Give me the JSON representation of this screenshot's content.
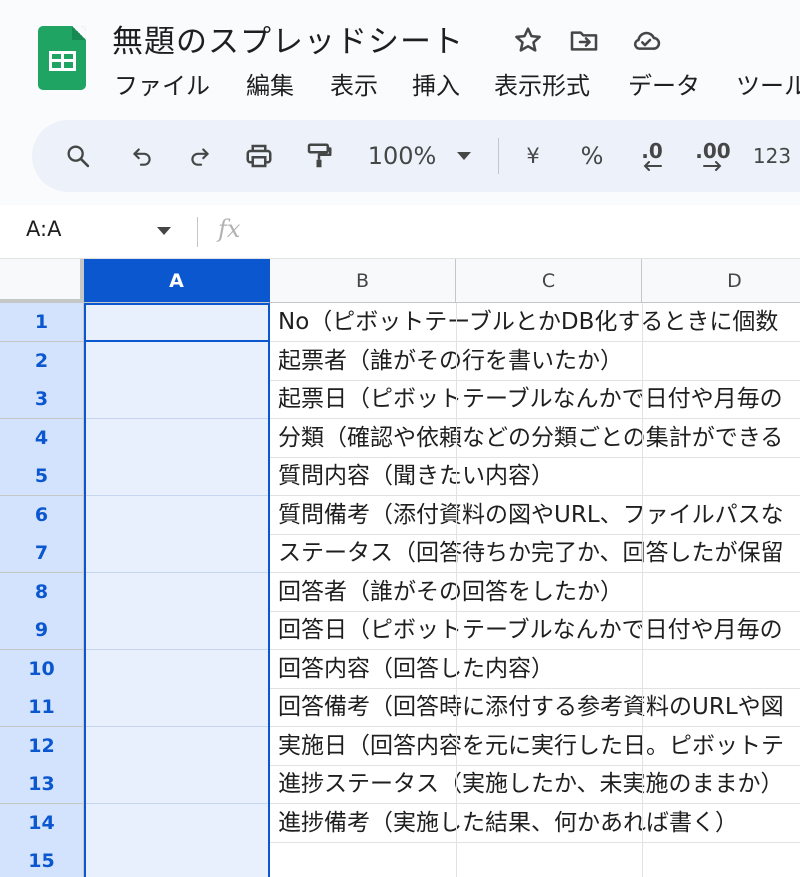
{
  "document": {
    "title": "無題のスプレッドシート",
    "title_icons": [
      "star-icon",
      "move-to-folder-icon",
      "cloud-saved-icon"
    ]
  },
  "menu": [
    "ファイル",
    "編集",
    "表示",
    "挿入",
    "表示形式",
    "データ",
    "ツール"
  ],
  "toolbar": {
    "zoom": "100%",
    "currency": "¥",
    "percent": "%",
    "decrease_decimal": ".0",
    "increase_decimal": ".00",
    "number_format": "123"
  },
  "formula_bar": {
    "name_box": "A:A",
    "fx_label": "fx"
  },
  "grid": {
    "columns": [
      "A",
      "B",
      "C",
      "D"
    ],
    "selected_column": "A",
    "rows": [
      {
        "number": "1",
        "b": "No（ピボットテーブルとかDB化するときに個数"
      },
      {
        "number": "2",
        "b": "起票者（誰がその行を書いたか）"
      },
      {
        "number": "3",
        "b": "起票日（ピボットテーブルなんかで日付や月毎の"
      },
      {
        "number": "4",
        "b": "分類（確認や依頼などの分類ごとの集計ができる"
      },
      {
        "number": "5",
        "b": "質問内容（聞きたい内容）"
      },
      {
        "number": "6",
        "b": "質問備考（添付資料の図やURL、ファイルパスな"
      },
      {
        "number": "7",
        "b": "ステータス（回答待ちか完了か、回答したが保留"
      },
      {
        "number": "8",
        "b": "回答者（誰がその回答をしたか）"
      },
      {
        "number": "9",
        "b": "回答日（ピボットテーブルなんかで日付や月毎の"
      },
      {
        "number": "10",
        "b": "回答内容（回答した内容）"
      },
      {
        "number": "11",
        "b": "回答備考（回答時に添付する参考資料のURLや図"
      },
      {
        "number": "12",
        "b": "実施日（回答内容を元に実行した日。ピボットテ"
      },
      {
        "number": "13",
        "b": "進捗ステータス（実施したか、未実施のままか）"
      },
      {
        "number": "14",
        "b": "進捗備考（実施した結果、何かあれば書く）"
      },
      {
        "number": "15",
        "b": ""
      }
    ]
  },
  "colors": {
    "accent": "#0b57d0",
    "selected_row_header": "#d3e3fd",
    "selected_cell_fill": "#e8f0fe",
    "logo_green": "#1fa463",
    "toolbar_bg": "#edf2fa"
  }
}
